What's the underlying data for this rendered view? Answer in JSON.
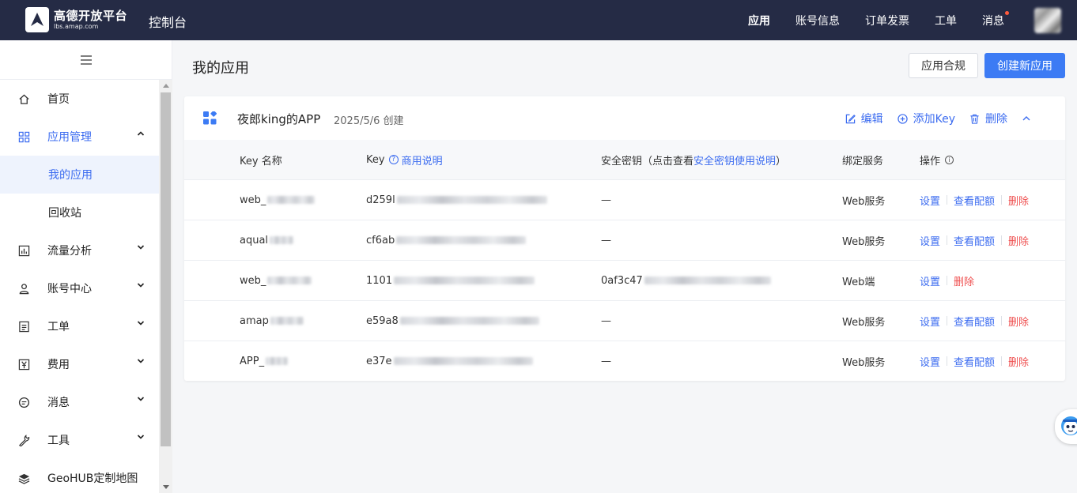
{
  "header": {
    "logo_name": "高德开放平台",
    "logo_domain": "lbs.amap.com",
    "console": "控制台",
    "nav": [
      {
        "label": "应用",
        "active": true
      },
      {
        "label": "账号信息"
      },
      {
        "label": "订单发票"
      },
      {
        "label": "工单"
      },
      {
        "label": "消息",
        "has_dot": true
      }
    ]
  },
  "sidebar": {
    "toggle_icon": "menu-icon",
    "items": [
      {
        "label": "首页",
        "icon": "home-icon"
      },
      {
        "label": "应用管理",
        "icon": "grid-icon",
        "expanded": true
      },
      {
        "label": "我的应用",
        "sub": true,
        "selected": true
      },
      {
        "label": "回收站",
        "sub": true
      },
      {
        "label": "流量分析",
        "icon": "chart-icon"
      },
      {
        "label": "账号中心",
        "icon": "user-icon"
      },
      {
        "label": "工单",
        "icon": "ticket-icon"
      },
      {
        "label": "费用",
        "icon": "yen-icon"
      },
      {
        "label": "消息",
        "icon": "message-icon"
      },
      {
        "label": "工具",
        "icon": "wrench-icon"
      },
      {
        "label": "GeoHUB定制地图",
        "icon": "layers-icon"
      }
    ]
  },
  "main": {
    "title": "我的应用",
    "compliance_button": "应用合规",
    "create_button": "创建新应用",
    "app": {
      "name": "夜郎king的APP",
      "created": "2025/5/6 创建",
      "actions": {
        "edit": "编辑",
        "add_key": "添加Key",
        "delete": "删除"
      }
    },
    "table": {
      "headers": {
        "name": "Key 名称",
        "key": "Key",
        "key_help": "商用说明",
        "secret_prefix": "安全密钥（点击查看",
        "secret_link": "安全密钥使用说明",
        "secret_suffix": "）",
        "service": "绑定服务",
        "ops": "操作"
      },
      "rows": [
        {
          "name": "web_",
          "key": "d259l",
          "secret": "—",
          "service": "Web服务",
          "ops": [
            "设置",
            "查看配额",
            "删除"
          ]
        },
        {
          "name": "aqual",
          "key": "cf6ab",
          "secret": "—",
          "service": "Web服务",
          "ops": [
            "设置",
            "查看配额",
            "删除"
          ]
        },
        {
          "name": "web_",
          "key": "1101",
          "secret": "0af3c47",
          "service": "Web端",
          "ops": [
            "设置",
            "删除"
          ]
        },
        {
          "name": "amap",
          "key": "e59a8",
          "secret": "—",
          "service": "Web服务",
          "ops": [
            "设置",
            "查看配额",
            "删除"
          ]
        },
        {
          "name": "APP_",
          "key": "e37e",
          "secret": "—",
          "service": "Web服务",
          "ops": [
            "设置",
            "查看配额",
            "删除"
          ]
        }
      ]
    }
  },
  "colors": {
    "topbar": "#252b45",
    "primary": "#3c7bf4",
    "link": "#3c6cf0",
    "danger": "#ef4f4f"
  }
}
